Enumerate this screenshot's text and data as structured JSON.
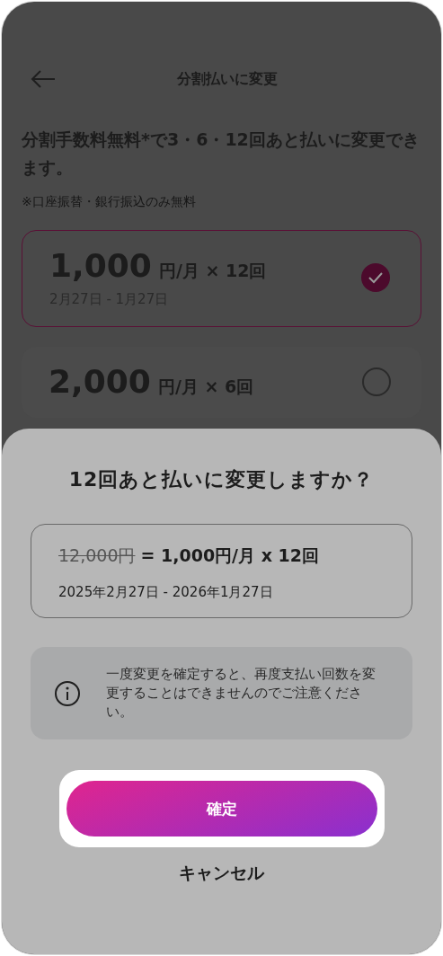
{
  "header": {
    "title": "分割払いに変更"
  },
  "intro": {
    "headline": "分割手数料無料*で3・6・12回あと払いに変更できます。",
    "note": "※口座振替・銀行振込のみ無料"
  },
  "options": [
    {
      "amount": "1,000",
      "unit": "円/月 × 12回",
      "period": "2月27日 - 1月27日",
      "selected": true
    },
    {
      "amount": "2,000",
      "unit": "円/月 × 6回",
      "selected": false
    }
  ],
  "dialog": {
    "title": "12回あと払いに変更しますか？",
    "summary": {
      "original_price": "12,000円",
      "result": "= 1,000円/月 x 12回",
      "period": "2025年2月27日 - 2026年1月27日"
    },
    "notice": "一度変更を確定すると、再度支払い回数を変更することはできませんのでご注意ください。",
    "confirm": "確定",
    "cancel": "キャンセル"
  }
}
